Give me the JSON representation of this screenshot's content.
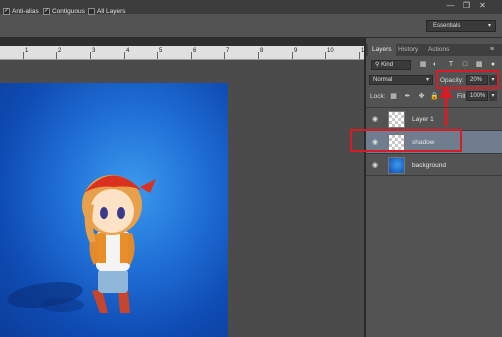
{
  "options": {
    "anti_alias": "Anti-alias",
    "contiguous": "Contiguous",
    "all_layers": "All Layers"
  },
  "workspace": "Essentials",
  "ruler": {
    "labels": [
      "1",
      "2",
      "3",
      "4",
      "5",
      "6",
      "7",
      "8",
      "9",
      "10",
      "11"
    ]
  },
  "panels": {
    "tabs": [
      "Layers",
      "History",
      "Actions"
    ],
    "filter": {
      "kind": "Kind"
    },
    "blend_mode": "Normal",
    "opacity": {
      "label": "Opacity:",
      "value": "20%"
    },
    "lock_label": "Lock:",
    "fill": {
      "label": "Fill:",
      "value": "100%"
    },
    "layers": [
      {
        "name": "Layer 1",
        "selected": false,
        "thumb": "transparent"
      },
      {
        "name": "shadow",
        "selected": true,
        "thumb": "transparent"
      },
      {
        "name": "background",
        "selected": false,
        "thumb": "blue"
      }
    ]
  },
  "colors": {
    "highlight": "#d61d25",
    "selected_layer": "#6f7d8f"
  }
}
